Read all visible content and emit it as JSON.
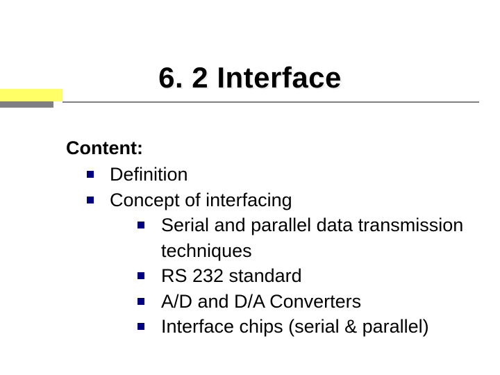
{
  "title": "6. 2    Interface",
  "content_label": "Content:",
  "items": [
    {
      "text": "Definition"
    },
    {
      "text": "Concept of interfacing",
      "sub": [
        "Serial and parallel data transmission techniques",
        "RS 232 standard",
        "A/D and D/A Converters",
        "Interface chips (serial & parallel)"
      ]
    }
  ]
}
